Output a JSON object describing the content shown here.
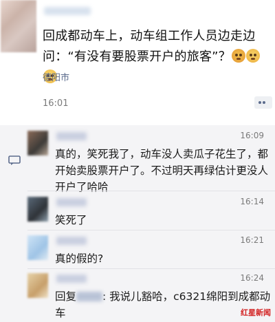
{
  "post": {
    "text_line1": "回成都动车上，动车组工作人员边走边",
    "text_line2": "问：“有没有要股票开户的旅客”？",
    "emojis": [
      "angry-face-emoji",
      "dizzy-face-emoji",
      "flushed-face-emoji"
    ],
    "location": "德阳市",
    "time": "16:01"
  },
  "comments": [
    {
      "time": "16:09",
      "text": "真的，笑死我了，动车没人卖瓜子花生了，都开始卖股票开户了。不过明天再绿估计更没人开户了哈哈"
    },
    {
      "time": "16:14",
      "text": "笑死了"
    },
    {
      "time": "16:21",
      "text": "真的假的?"
    },
    {
      "time": "16:24",
      "reply_prefix": "回复",
      "text": ": 我说儿豁哈，c6321绵阳到成都动车"
    }
  ],
  "watermark": "红星新闻"
}
